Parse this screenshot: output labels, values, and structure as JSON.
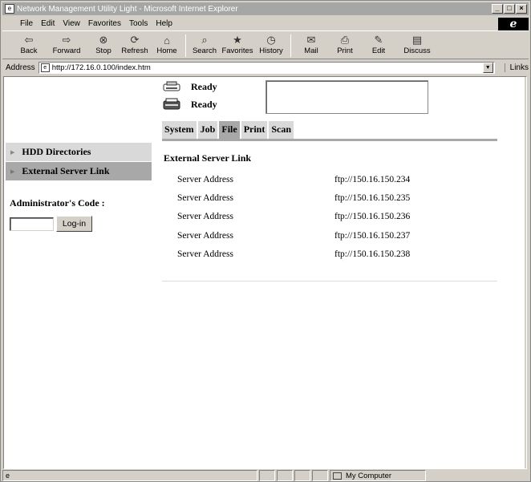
{
  "window": {
    "title": "Network Management Utility Light - Microsoft Internet Explorer",
    "buttons": [
      "_",
      "□",
      "×"
    ]
  },
  "menu": [
    "File",
    "Edit",
    "View",
    "Favorites",
    "Tools",
    "Help"
  ],
  "toolbar": [
    {
      "label": "Back",
      "icon": "back-arrow-icon"
    },
    {
      "label": "Forward",
      "icon": "forward-arrow-icon"
    },
    {
      "label": "Stop",
      "icon": "stop-icon"
    },
    {
      "label": "Refresh",
      "icon": "refresh-icon"
    },
    {
      "label": "Home",
      "icon": "home-icon"
    },
    {
      "label": "Search",
      "icon": "search-icon"
    },
    {
      "label": "Favorites",
      "icon": "favorites-icon"
    },
    {
      "label": "History",
      "icon": "history-icon"
    },
    {
      "label": "Mail",
      "icon": "mail-icon"
    },
    {
      "label": "Print",
      "icon": "print-icon"
    },
    {
      "label": "Edit",
      "icon": "edit-icon"
    },
    {
      "label": "Discuss",
      "icon": "discuss-icon"
    }
  ],
  "address": {
    "label": "Address",
    "url": "http://172.16.0.100/index.htm",
    "links_label": "Links"
  },
  "device_status": [
    {
      "icon": "printer-icon",
      "text": "Ready"
    },
    {
      "icon": "scanner-icon",
      "text": "Ready"
    }
  ],
  "tabs": [
    {
      "label": "System",
      "active": false
    },
    {
      "label": "Job",
      "active": false
    },
    {
      "label": "File",
      "active": true
    },
    {
      "label": "Print",
      "active": false
    },
    {
      "label": "Scan",
      "active": false
    }
  ],
  "nav": [
    {
      "label": "HDD Directories",
      "active": false
    },
    {
      "label": "External Server Link",
      "active": true
    }
  ],
  "admin": {
    "label": "Administrator's Code :",
    "input_value": "",
    "login_label": "Log-in"
  },
  "section": {
    "title": "External Server Link",
    "rows": [
      {
        "key": "Server Address",
        "value": "ftp://150.16.150.234"
      },
      {
        "key": "Server Address",
        "value": "ftp://150.16.150.235"
      },
      {
        "key": "Server Address",
        "value": "ftp://150.16.150.236"
      },
      {
        "key": "Server Address",
        "value": "ftp://150.16.150.237"
      },
      {
        "key": "Server Address",
        "value": "ftp://150.16.150.238"
      }
    ]
  },
  "statusbar": {
    "zone": "My Computer"
  },
  "colors": {
    "tab_active": "#a8a8a8",
    "tab_inactive": "#d9d9d9",
    "chrome": "#d4d0c8"
  }
}
